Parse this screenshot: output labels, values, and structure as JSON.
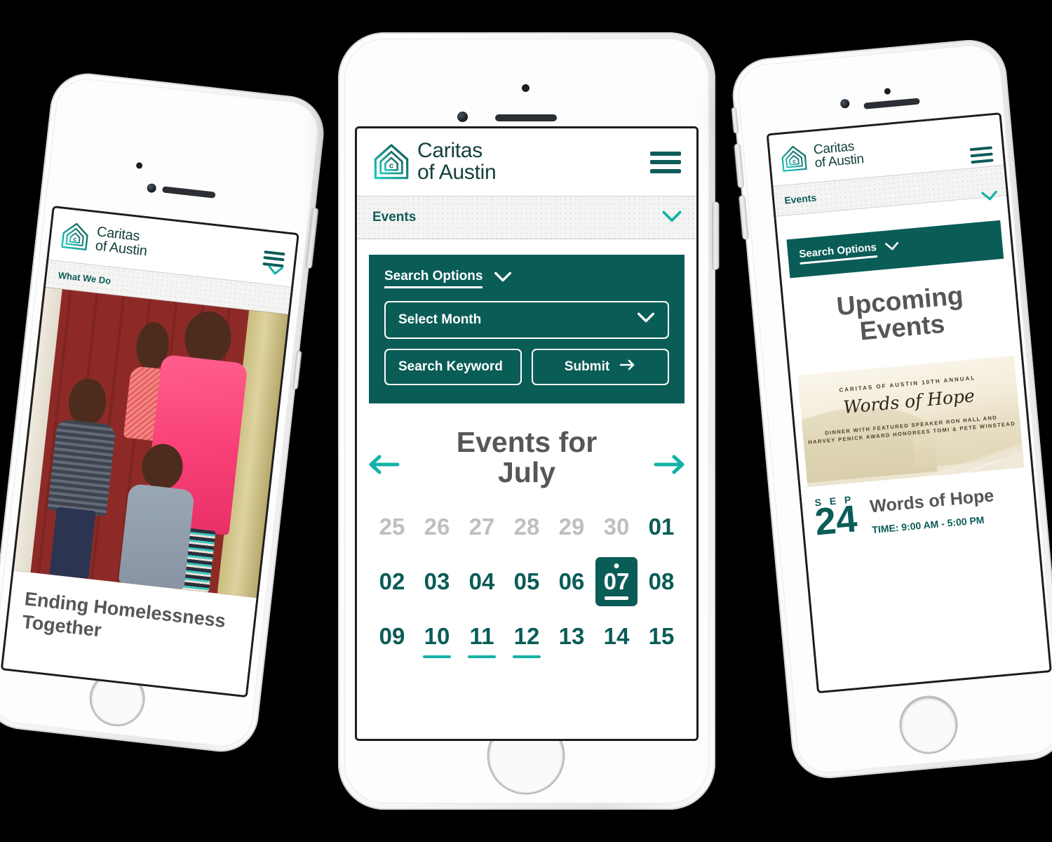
{
  "brand": {
    "line1": "Caritas",
    "line2": "of Austin",
    "logo_icon": "house-logo-icon",
    "logo_letter": "c",
    "menu_icon": "hamburger-menu-icon"
  },
  "colors": {
    "dark_green": "#0a5c57",
    "teal": "#13b2a6",
    "brand_text": "#13403c",
    "heading_gray": "#565656",
    "muted_day": "#bfbfbf"
  },
  "phone1": {
    "breadcrumb": "What We Do",
    "chevron_icon": "chevron-down-icon",
    "hero_heading": "Ending Homelessness Together",
    "hero_photo_alt": "family-photo"
  },
  "phone2": {
    "breadcrumb": "Events",
    "chevron_icon": "chevron-down-icon",
    "search": {
      "title": "Search Options",
      "toggle_icon": "chevron-down-icon",
      "month_select_value": "Select Month",
      "month_select_icon": "chevron-down-icon",
      "keyword_placeholder": "Search Keyword",
      "submit_label": "Submit",
      "submit_icon": "arrow-right-icon"
    },
    "calendar": {
      "title_line1": "Events for",
      "title_line2": "July",
      "prev_icon": "arrow-left-icon",
      "next_icon": "arrow-right-icon",
      "selected_day": "07",
      "weeks": [
        [
          {
            "label": "25",
            "state": "muted"
          },
          {
            "label": "26",
            "state": "muted"
          },
          {
            "label": "27",
            "state": "muted"
          },
          {
            "label": "28",
            "state": "muted"
          },
          {
            "label": "29",
            "state": "muted"
          },
          {
            "label": "30",
            "state": "muted"
          },
          {
            "label": "01",
            "state": "normal"
          }
        ],
        [
          {
            "label": "02",
            "state": "normal"
          },
          {
            "label": "03",
            "state": "normal"
          },
          {
            "label": "04",
            "state": "normal"
          },
          {
            "label": "05",
            "state": "normal"
          },
          {
            "label": "06",
            "state": "normal"
          },
          {
            "label": "07",
            "state": "selected"
          },
          {
            "label": "08",
            "state": "normal"
          }
        ],
        [
          {
            "label": "09",
            "state": "normal"
          },
          {
            "label": "10",
            "state": "hasevent"
          },
          {
            "label": "11",
            "state": "hasevent"
          },
          {
            "label": "12",
            "state": "hasevent"
          },
          {
            "label": "13",
            "state": "normal"
          },
          {
            "label": "14",
            "state": "normal"
          },
          {
            "label": "15",
            "state": "normal"
          }
        ]
      ]
    }
  },
  "phone3": {
    "breadcrumb": "Events",
    "chevron_icon": "chevron-down-icon",
    "search_title": "Search Options",
    "search_toggle_icon": "chevron-down-icon",
    "heading_line1": "Upcoming",
    "heading_line2": "Events",
    "event": {
      "poster_kicker": "CARITAS OF AUSTIN 10TH ANNUAL",
      "poster_title": "Words of Hope",
      "poster_line1": "DINNER WITH FEATURED SPEAKER RON HALL AND",
      "poster_line2": "HARVEY PENICK AWARD HONOREES TOMI & PETE WINSTEAD",
      "month": "S E P",
      "day": "24",
      "title": "Words of Hope",
      "time": "TIME: 9:00 AM - 5:00 PM"
    }
  }
}
